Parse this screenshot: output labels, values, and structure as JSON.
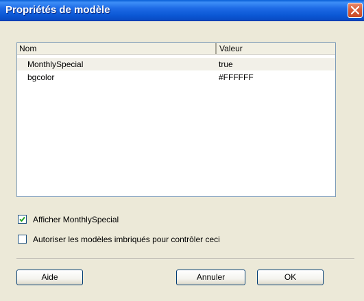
{
  "window": {
    "title": "Propriétés de modèle"
  },
  "list": {
    "columns": [
      "Nom",
      "Valeur"
    ],
    "rows": [
      {
        "name": "MonthlySpecial",
        "value": "true"
      },
      {
        "name": "bgcolor",
        "value": "#FFFFFF"
      }
    ]
  },
  "options": {
    "show_label": "Afficher MonthlySpecial",
    "show_checked": true,
    "nested_label": "Autoriser les modèles imbriqués pour contrôler ceci",
    "nested_checked": false
  },
  "buttons": {
    "help": "Aide",
    "cancel": "Annuler",
    "ok": "OK"
  },
  "colors": {
    "titlebar": "#0B57D4",
    "close": "#D85E3A",
    "dialog_bg": "#ECE9D8"
  }
}
